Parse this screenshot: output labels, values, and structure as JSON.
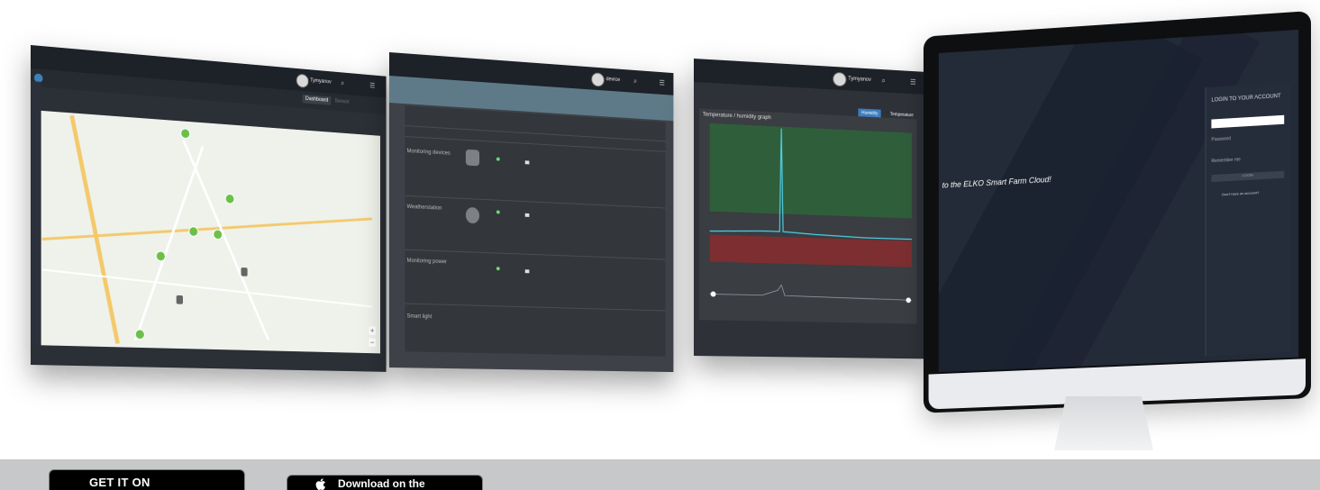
{
  "screens": {
    "map": {
      "username": "Tymyanov",
      "dashboard_button": "Dashboard",
      "search_hint": "Sensor"
    },
    "devices": {
      "username": "device",
      "rows": [
        {
          "label": "Monitoring devices"
        },
        {
          "label": "Weatherstation"
        },
        {
          "label": "Monitoring power"
        },
        {
          "label": "Smart light"
        }
      ]
    },
    "graph": {
      "username": "Tymyanov",
      "title": "Temperature / humidity graph",
      "btn_humidity": "Humidity",
      "btn_temperature": "Temperature"
    },
    "login": {
      "welcome": "to the ELKO Smart Farm Cloud!",
      "heading": "LOGIN TO YOUR ACCOUNT",
      "password_placeholder": "Password",
      "remember": "Remember me",
      "login_button": "LOGIN",
      "no_account": "Don't have an account?"
    }
  },
  "store_buttons": {
    "google_play": "GET IT ON",
    "app_store": "Download on the"
  },
  "colors": {
    "topbar": "#1d2128",
    "map_green": "#6cc04a",
    "graph_green": "#2f5e3b",
    "graph_red": "#7c2e30",
    "band": "#c6c8c9"
  }
}
